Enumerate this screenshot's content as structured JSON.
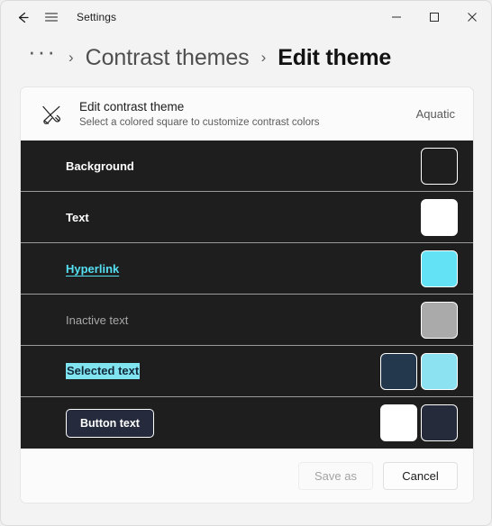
{
  "window": {
    "title": "Settings",
    "back_icon": "back-arrow-icon",
    "menu_icon": "hamburger-menu-icon",
    "minimize_icon": "minimize-icon",
    "maximize_icon": "maximize-icon",
    "close_icon": "close-icon"
  },
  "breadcrumb": {
    "overflow": "···",
    "separator": "›",
    "parent": "Contrast themes",
    "current": "Edit theme"
  },
  "card": {
    "icon": "edit-theme-brush-pencil-icon",
    "title": "Edit contrast theme",
    "subtitle": "Select a colored square to customize contrast colors",
    "theme_name": "Aquatic"
  },
  "preview": {
    "background_color": "#1e1e1e",
    "separator_color": "#9a9a9a",
    "rows": [
      {
        "name": "background",
        "label": "Background",
        "style": "plain",
        "text_color": "#ffffff",
        "swatches": [
          {
            "name": "background-color-swatch",
            "color": "#1e1e1e"
          }
        ]
      },
      {
        "name": "text",
        "label": "Text",
        "style": "plain",
        "text_color": "#ffffff",
        "swatches": [
          {
            "name": "text-color-swatch",
            "color": "#ffffff"
          }
        ]
      },
      {
        "name": "hyperlink",
        "label": "Hyperlink",
        "style": "link",
        "text_color": "#55e0f2",
        "swatches": [
          {
            "name": "hyperlink-color-swatch",
            "color": "#63e2f5"
          }
        ]
      },
      {
        "name": "inactive-text",
        "label": "Inactive text",
        "style": "inactive",
        "text_color": "#a8a8a8",
        "swatches": [
          {
            "name": "inactive-text-color-swatch",
            "color": "#aaaaaa"
          }
        ]
      },
      {
        "name": "selected-text",
        "label": "Selected text",
        "style": "selected",
        "text_color": "#12293a",
        "highlight_color": "#7fe4f0",
        "swatches": [
          {
            "name": "selected-text-foreground-swatch",
            "color": "#24384d"
          },
          {
            "name": "selected-text-background-swatch",
            "color": "#8ce2f0"
          }
        ]
      },
      {
        "name": "button-text",
        "label": "Button text",
        "style": "button",
        "text_color": "#ffffff",
        "button_fill": "#252b3d",
        "swatches": [
          {
            "name": "button-text-foreground-swatch",
            "color": "#ffffff"
          },
          {
            "name": "button-text-background-swatch",
            "color": "#262b3c"
          }
        ]
      }
    ]
  },
  "footer": {
    "save_as_label": "Save as",
    "save_as_enabled": false,
    "cancel_label": "Cancel"
  }
}
